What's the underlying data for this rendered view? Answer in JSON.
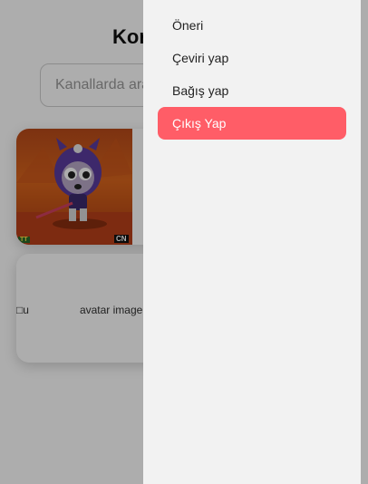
{
  "page": {
    "title": "Kor",
    "search_placeholder": "Kanallarda ara"
  },
  "cards": {
    "thumb_badge_left": "TT",
    "thumb_badge_right": "CN",
    "broken_image_prefix": "u",
    "broken_image_suffix": "avatar image"
  },
  "menu": {
    "items": [
      {
        "label": "Öneri"
      },
      {
        "label": "Çeviri yap"
      },
      {
        "label": "Bağış yap"
      },
      {
        "label": "Çıkış Yap",
        "active": true
      }
    ]
  },
  "colors": {
    "active_bg": "#ff5d67",
    "drawer_bg": "#f2f2f2",
    "overlay": "rgba(0,0,0,0.32)"
  }
}
